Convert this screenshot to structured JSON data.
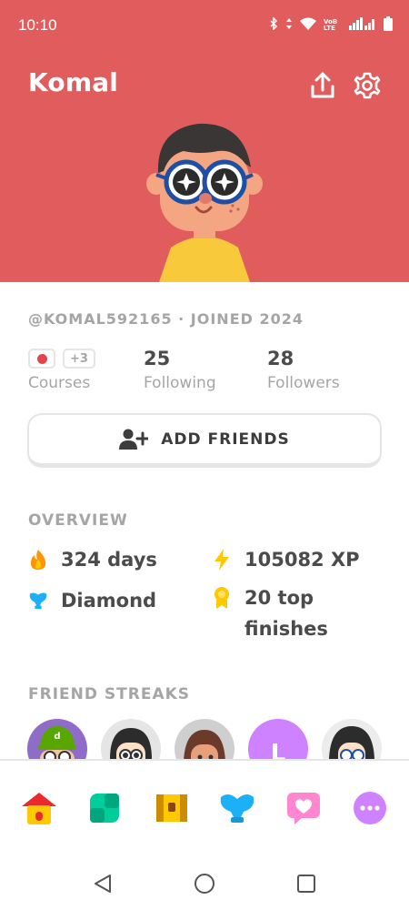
{
  "status_bar": {
    "time": "10:10",
    "network": "VoB LTE"
  },
  "profile": {
    "name": "Komal",
    "username_joined": "@KOMAL592165 · JOINED 2024"
  },
  "stats": {
    "courses_more": "+3",
    "courses_label": "Courses",
    "following_value": "25",
    "following_label": "Following",
    "followers_value": "28",
    "followers_label": "Followers"
  },
  "add_friends_label": "ADD FRIENDS",
  "overview": {
    "title": "OVERVIEW",
    "streak": "324 days",
    "xp": "105082 XP",
    "league": "Diamond",
    "top_finishes_line1": "20 top",
    "top_finishes_line2": "finishes"
  },
  "friend_streaks": {
    "title": "FRIEND STREAKS",
    "friend_initial": "L",
    "cap_letter": "d"
  },
  "icons": {
    "share": "share-icon",
    "settings": "gear-icon",
    "flag": "japan-flag-icon",
    "add_friend": "add-friend-icon",
    "streak": "fire-icon",
    "xp": "lightning-icon",
    "league": "diamond-trophy-icon",
    "top_finishes": "medal-icon",
    "nav": [
      "home-icon",
      "practice-icon",
      "chest-icon",
      "leagues-icon",
      "friends-heart-icon",
      "more-icon"
    ],
    "system": [
      "back-icon",
      "home-circle-icon",
      "recents-icon"
    ]
  },
  "colors": {
    "header": "#e15d5d",
    "accent_blue": "#1cb0f6",
    "muted_text": "#a5a5a5"
  }
}
